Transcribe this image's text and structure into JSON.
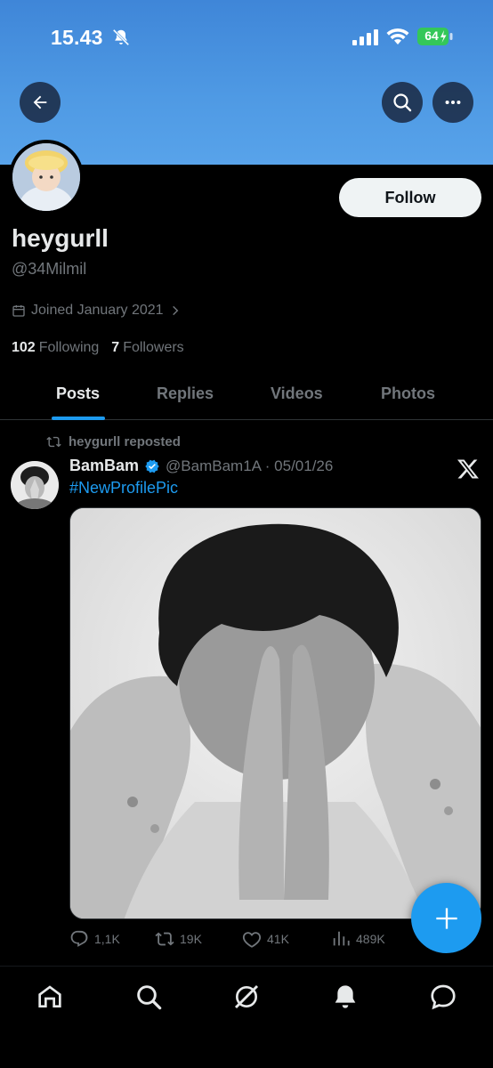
{
  "status_bar": {
    "time": "15.43",
    "battery": "64",
    "icons": [
      "bell-slash-icon",
      "cellular-signal-icon",
      "wifi-icon",
      "battery-charging-icon"
    ]
  },
  "header": {
    "icons": [
      "back-arrow-icon",
      "search-icon",
      "more-horizontal-icon"
    ]
  },
  "profile": {
    "display_name": "heygurll",
    "handle": "@34Milmil",
    "joined": "Joined January 2021",
    "following_count": "102",
    "following_label": "Following",
    "followers_count": "7",
    "followers_label": "Followers",
    "follow_button": "Follow"
  },
  "tabs": [
    {
      "label": "Posts",
      "active": true
    },
    {
      "label": "Replies",
      "active": false
    },
    {
      "label": "Videos",
      "active": false
    },
    {
      "label": "Photos",
      "active": false
    }
  ],
  "tweet": {
    "repost_label": "heygurll reposted",
    "author_name": "BamBam",
    "author_meta": "@BamBam1A · 05/01/26",
    "verified": true,
    "text": "#NewProfilePic",
    "replies": "1,1K",
    "reposts": "19K",
    "likes": "41K",
    "views": "489K"
  },
  "bottom_nav": [
    "home-icon",
    "search-icon",
    "grok-icon",
    "notifications-icon",
    "messages-icon"
  ],
  "colors": {
    "accent": "#1d9bf0",
    "banner": "#4f9ae4",
    "background": "#000000",
    "muted": "#71767b"
  }
}
